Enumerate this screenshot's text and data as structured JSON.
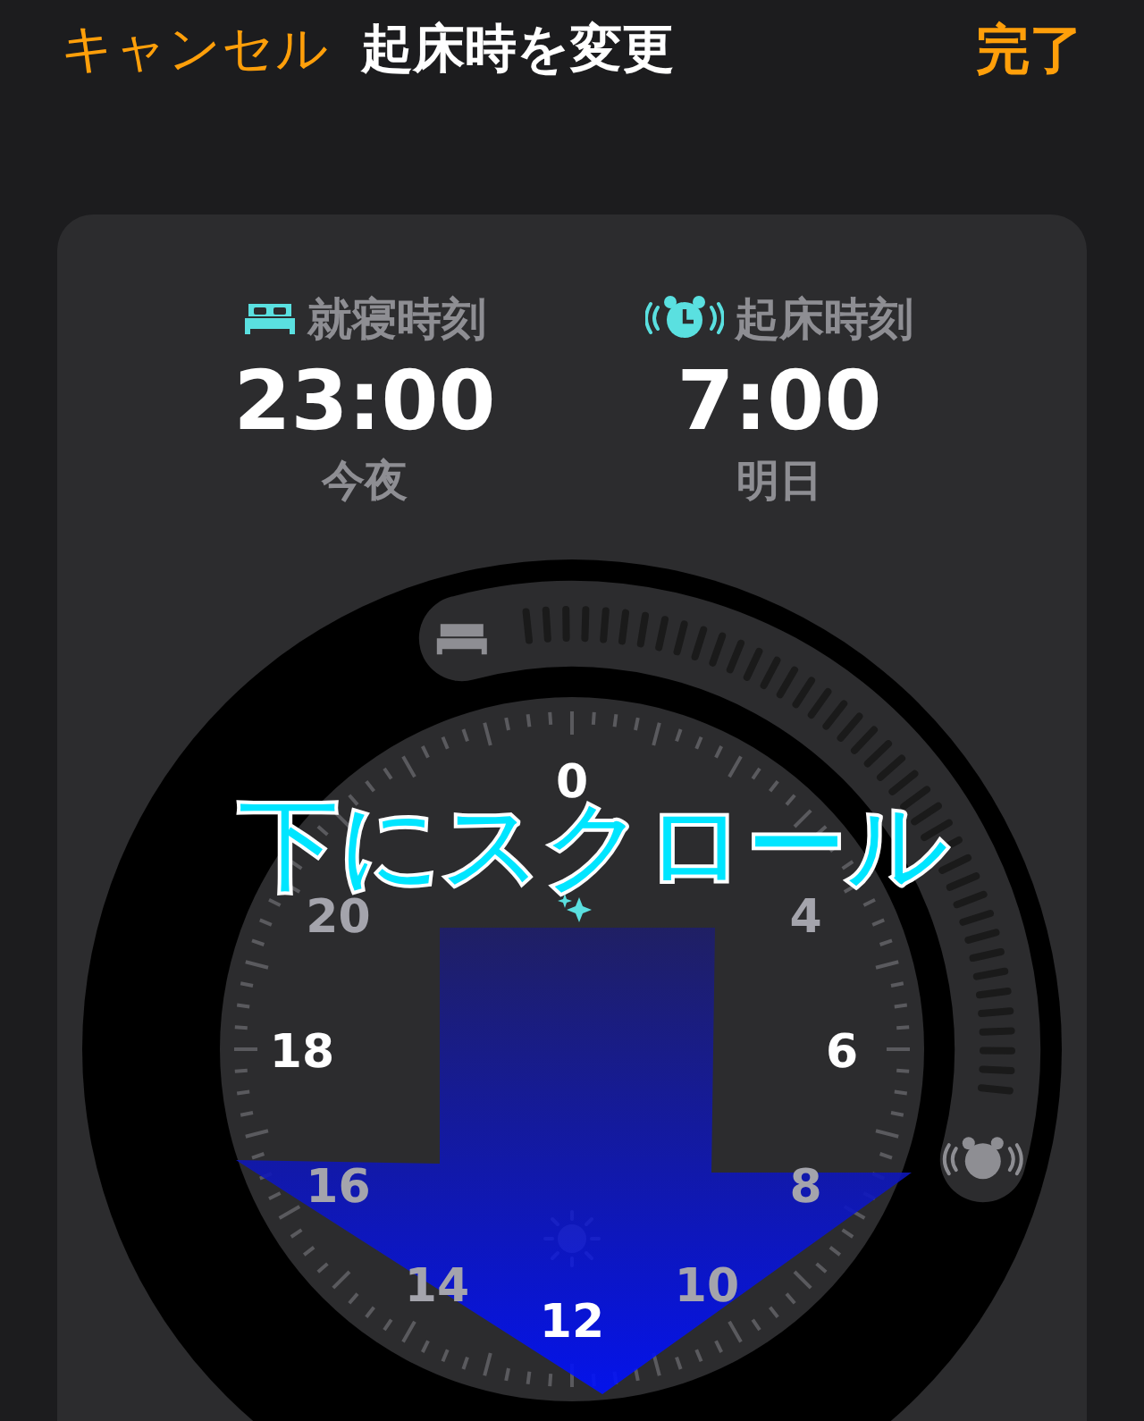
{
  "header": {
    "cancel": "キャンセル",
    "title": "起床時を変更",
    "done": "完了"
  },
  "bedtime": {
    "label": "就寝時刻",
    "time": "23:00",
    "day": "今夜"
  },
  "wakeup": {
    "label": "起床時刻",
    "time": "7:00",
    "day": "明日"
  },
  "dial": {
    "hour_labels": [
      {
        "label": "0",
        "major": true
      },
      {
        "label": "4",
        "major": false
      },
      {
        "label": "6",
        "major": true
      },
      {
        "label": "8",
        "major": false
      },
      {
        "label": "10",
        "major": false
      },
      {
        "label": "12",
        "major": true
      },
      {
        "label": "14",
        "major": false
      },
      {
        "label": "16",
        "major": false
      },
      {
        "label": "18",
        "major": true
      },
      {
        "label": "20",
        "major": false
      }
    ]
  },
  "annotation": {
    "text": "下にスクロール"
  }
}
